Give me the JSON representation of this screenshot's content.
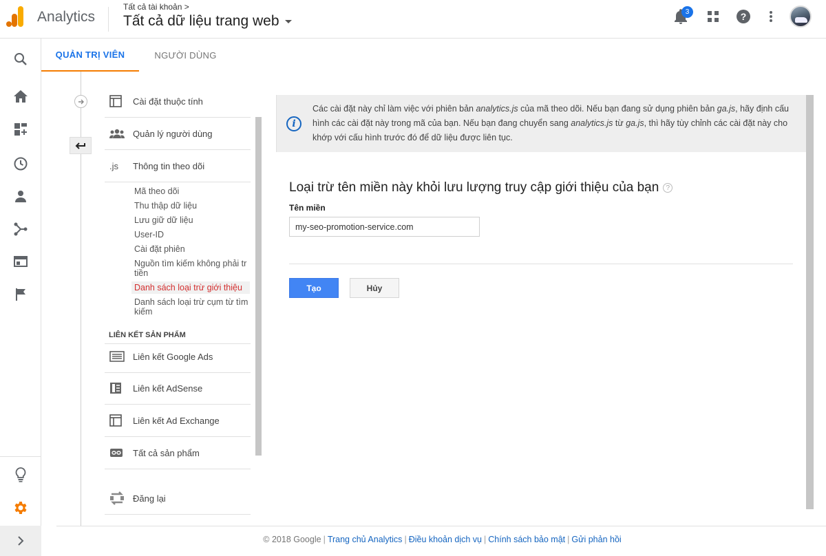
{
  "header": {
    "app_name": "Analytics",
    "breadcrumb": "Tất cả tài khoản >",
    "property_selector": "Tất cả dữ liệu trang web",
    "notification_count": "3"
  },
  "rail": {
    "items": [
      "search-icon",
      "home-icon",
      "customization-icon",
      "realtime-icon",
      "audience-icon",
      "acquisition-icon",
      "behavior-icon",
      "conversions-icon"
    ],
    "bottom": [
      "discover-icon",
      "admin-gear-icon",
      "expand-icon"
    ]
  },
  "tabs": [
    {
      "label": "QUẢN TRỊ VIÊN",
      "active": true
    },
    {
      "label": "NGƯỜI DÙNG",
      "active": false
    }
  ],
  "nav": {
    "items": [
      {
        "label": "Cài đặt thuộc tính",
        "icon": "property-settings-icon"
      },
      {
        "label": "Quản lý người dùng",
        "icon": "users-icon"
      },
      {
        "label": "Thông tin theo dõi",
        "icon": "js-icon",
        "icon_text": ".js"
      }
    ],
    "sub_items": [
      "Mã theo dõi",
      "Thu thập dữ liệu",
      "Lưu giữ dữ liệu",
      "User-ID",
      "Cài đặt phiên",
      "Nguồn tìm kiếm không phải trả tiền",
      "Danh sách loại trừ giới thiệu",
      "Danh sách loại trừ cụm từ tìm kiếm"
    ],
    "sub_item_lines": [
      [
        "Mã theo dõi"
      ],
      [
        "Thu thập dữ liệu"
      ],
      [
        "Lưu giữ dữ liệu"
      ],
      [
        "User-ID"
      ],
      [
        "Cài đặt phiên"
      ],
      [
        "Nguồn tìm kiếm không phải tr",
        "tiền"
      ],
      [
        "Danh sách loại trừ giới thiệu"
      ],
      [
        "Danh sách loại trừ cụm từ tìm",
        "kiếm"
      ]
    ],
    "active_sub_index": 6,
    "section_title": "LIÊN KẾT SẢN PHẨM",
    "product_links": [
      {
        "label": "Liên kết Google Ads",
        "icon": "google-ads-icon"
      },
      {
        "label": "Liên kết AdSense",
        "icon": "adsense-icon"
      },
      {
        "label": "Liên kết Ad Exchange",
        "icon": "ad-exchange-icon"
      },
      {
        "label": "Tất cả sản phẩm",
        "icon": "all-products-link-icon"
      }
    ],
    "postbacks": {
      "label": "Đăng lại",
      "icon": "postbacks-icon"
    }
  },
  "info": {
    "text_parts": [
      {
        "t": "Các cài đặt này chỉ làm việc với phiên bản ",
        "em": false
      },
      {
        "t": "analytics.js",
        "em": true
      },
      {
        "t": " của mã theo dõi. Nếu bạn đang sử dụng phiên bản ",
        "em": false
      },
      {
        "t": "ga.js",
        "em": true
      },
      {
        "t": ", hãy định cấu hình các cài đặt này trong mã của bạn. Nếu bạn đang chuyển sang ",
        "em": false
      },
      {
        "t": "analytics.js",
        "em": true
      },
      {
        "t": " từ ",
        "em": false
      },
      {
        "t": "ga.js",
        "em": true
      },
      {
        "t": ", thì hãy tùy chỉnh các cài đặt này cho khớp với cấu hình trước đó để dữ liệu được liên tục.",
        "em": false
      }
    ]
  },
  "form": {
    "title": "Loại trừ tên miền này khỏi lưu lượng truy cập giới thiệu của bạn",
    "help": "?",
    "domain_label": "Tên miền",
    "domain_value": "my-seo-promotion-service.com",
    "create_label": "Tạo",
    "cancel_label": "Hủy"
  },
  "footer": {
    "copyright": "© 2018 Google",
    "links": [
      "Trang chủ Analytics",
      "Điều khoản dịch vụ",
      "Chính sách bảo mật",
      "Gửi phản hồi"
    ]
  },
  "colors": {
    "accent": "#1a73e8",
    "tab_underline": "#f57c00",
    "active_link": "#d32f2f",
    "button_primary": "#4285f4",
    "admin_gear": "#f57c00"
  }
}
